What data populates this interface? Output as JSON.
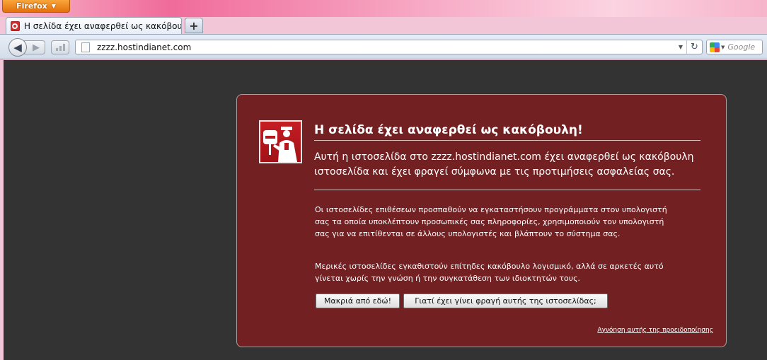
{
  "browser": {
    "app_button_label": "Firefox",
    "tab_title": "Η σελίδα έχει αναφερθεί ως κακόβουλη!",
    "new_tab_label": "+",
    "url": "zzzz.hostindianet.com",
    "search_placeholder": "Google"
  },
  "error": {
    "title": "Η σελίδα έχει αναφερθεί ως κακόβουλη!",
    "intro": "Αυτή η ιστοσελίδα στο  zzzz.hostindianet.com έχει αναφερθεί ως κακόβουλη ιστοσελίδα και έχει φραγεί σύμφωνα με τις προτιμήσεις ασφαλείας σας.",
    "paragraph1": "Οι ιστοσελίδες επιθέσεων προσπαθούν να εγκαταστήσουν προγράμματα στον υπολογιστή σας τα οποία υποκλέπτουν προσωπικές σας πληροφορίες, χρησιμοποιούν τον υπολογιστή σας για να επιτίθενται σε άλλους υπολογιστές και βλάπτουν το σύστημα σας.",
    "paragraph2": "Μερικές ιστοσελίδες εγκαθιστούν επίτηδες κακόβουλο λογισμικό, αλλά σε αρκετές αυτό γίνεται χωρίς την γνώση ή την συγκατάθεση των ιδιοκτητών τους.",
    "get_away_button": "Μακριά από εδώ!",
    "why_blocked_button": "Γιατί έχει γίνει φραγή αυτής της ιστοσελίδας;",
    "ignore_link": "Αγνόηση αυτής της προειδοποίησης"
  },
  "colors": {
    "error_background": "#722022",
    "content_background": "#333333",
    "firefox_orange": "#e3700c"
  },
  "icons": [
    "firefox-menu-icon",
    "tab-favicon-icon",
    "back-arrow-icon",
    "forward-arrow-icon",
    "page-icon",
    "reload-icon",
    "google-icon",
    "police-shield-icon"
  ]
}
